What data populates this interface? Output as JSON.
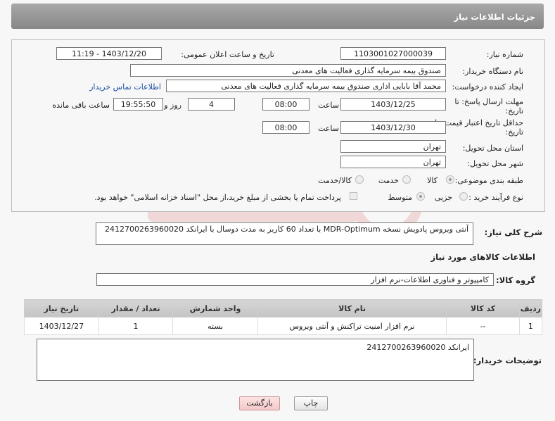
{
  "header": {
    "title": "جزئیات اطلاعات نیاز"
  },
  "form": {
    "need_number_label": "شماره نیاز:",
    "need_number": "1103001027000039",
    "announce_label": "تاریخ و ساعت اعلان عمومی:",
    "announce_value": "1403/12/20 - 11:19",
    "buyer_label": "نام دستگاه خریدار:",
    "buyer_value": "صندوق بیمه سرمایه گذاری فعالیت های معدنی",
    "creator_label": "ایجاد کننده درخواست:",
    "creator_value": "محمد آقا بابایی اداری صندوق بیمه سرمایه گذاری فعالیت های معدنی",
    "contact_link": "اطلاعات تماس خریدار",
    "deadline_label1": "مهلت ارسال پاسخ: تا",
    "deadline_label2": "تاریخ:",
    "deadline_date": "1403/12/25",
    "time_label": "ساعت",
    "deadline_time": "08:00",
    "days_value": "4",
    "days_label": "روز و",
    "remaining_time": "19:55:50",
    "remaining_label": "ساعت باقی مانده",
    "validity_label1": "حداقل تاریخ اعتبار قیمت: تا",
    "validity_label2": "تاریخ:",
    "validity_date": "1403/12/30",
    "validity_time": "08:00",
    "province_label": "استان محل تحویل:",
    "province_value": "تهران",
    "city_label": "شهر محل تحویل:",
    "city_value": "تهران",
    "category_label": "طبقه بندی موضوعی:",
    "category_options": [
      "کالا",
      "خدمت",
      "کالا/خدمت"
    ],
    "process_label": "نوع فرآیند خرید :",
    "process_options": [
      "جزیی",
      "متوسط"
    ],
    "payment_text": "پرداخت تمام یا بخشی از مبلغ خرید،از محل \"اسناد خزانه اسلامی\" خواهد بود."
  },
  "description": {
    "label": "شرح کلی نیاز:",
    "value": "آنتی ویروس پادویش نسخه MDR-Optimum با تعداد 60 کاربر به مدت دوسال با ایرانکد 2412700263960020"
  },
  "goods_info": {
    "title": "اطلاعات کالاهای مورد نیاز",
    "group_label": "گروه کالا:",
    "group_value": "کامپیوتر و فناوری اطلاعات-نرم افزار"
  },
  "table": {
    "headers": [
      "ردیف",
      "کد کالا",
      "نام کالا",
      "واحد شمارش",
      "تعداد / مقدار",
      "تاریخ نیاز"
    ],
    "rows": [
      [
        "1",
        "--",
        "نرم افزار امنیت تراکنش و آنتی ویروس",
        "بسته",
        "1",
        "1403/12/27"
      ]
    ]
  },
  "buyer_notes": {
    "label": "توضیحات خریدار:",
    "value": "ایرانکد 2412700263960020"
  },
  "buttons": {
    "print": "چاپ",
    "back": "بازگشت"
  }
}
